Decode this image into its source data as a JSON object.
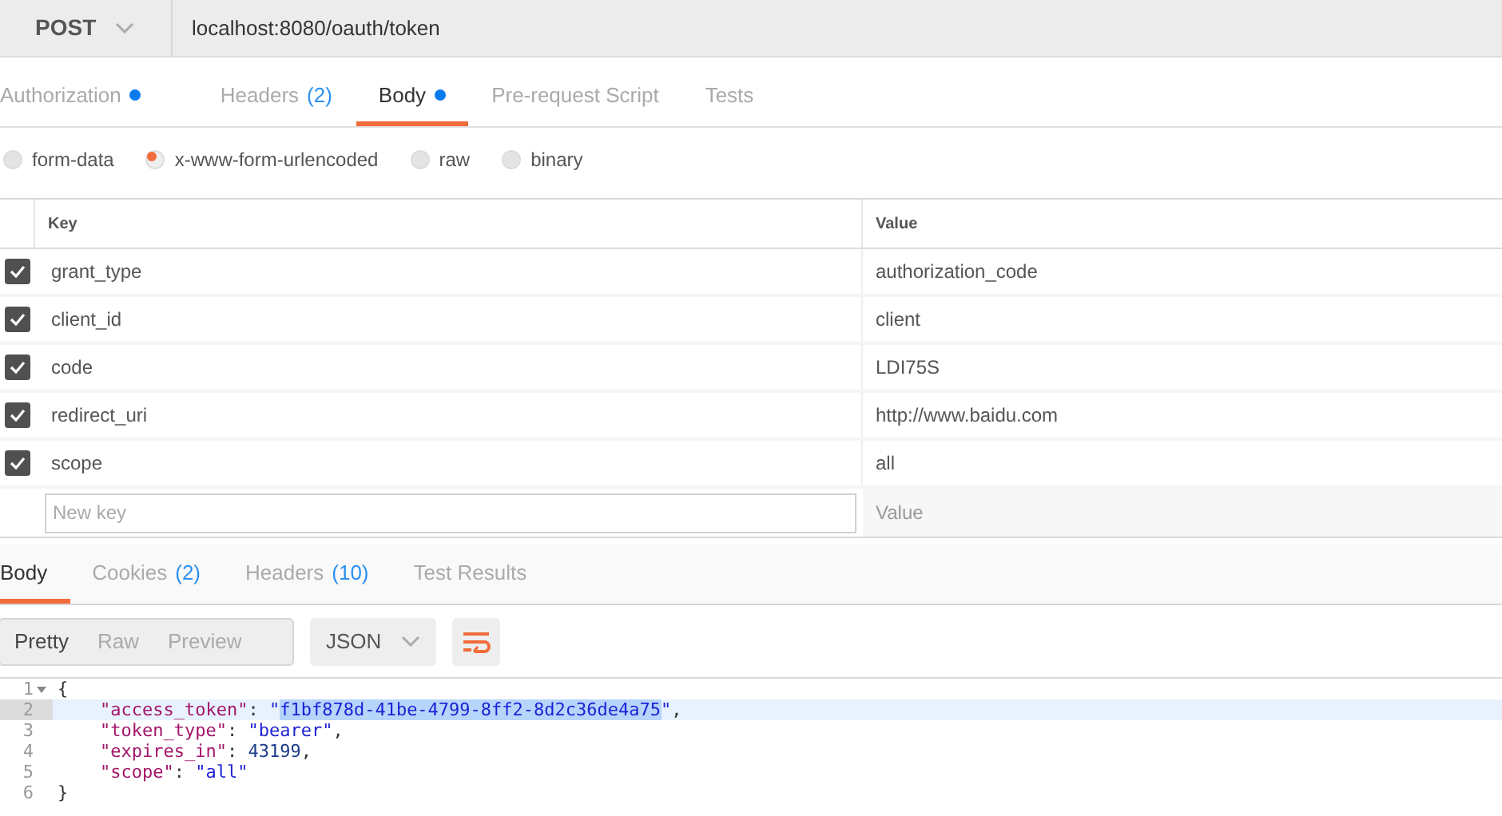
{
  "request": {
    "method": "POST",
    "url": "localhost:8080/oauth/token"
  },
  "request_tabs": [
    {
      "label": "Authorization",
      "dot": true,
      "selected": false
    },
    {
      "label": "Headers",
      "count": "(2)",
      "dot": false,
      "selected": false
    },
    {
      "label": "Body",
      "dot": true,
      "selected": true
    },
    {
      "label": "Pre-request Script",
      "dot": false,
      "selected": false
    },
    {
      "label": "Tests",
      "dot": false,
      "selected": false
    }
  ],
  "body_types": [
    {
      "label": "form-data",
      "selected": false
    },
    {
      "label": "x-www-form-urlencoded",
      "selected": true
    },
    {
      "label": "raw",
      "selected": false
    },
    {
      "label": "binary",
      "selected": false
    }
  ],
  "params_table": {
    "columns": [
      "Key",
      "Value"
    ],
    "rows": [
      {
        "key": "grant_type",
        "value": "authorization_code",
        "checked": true
      },
      {
        "key": "client_id",
        "value": "client",
        "checked": true
      },
      {
        "key": "code",
        "value": "LDI75S",
        "checked": true
      },
      {
        "key": "redirect_uri",
        "value": "http://www.baidu.com",
        "checked": true
      },
      {
        "key": "scope",
        "value": "all",
        "checked": true
      }
    ],
    "new_row": {
      "key_placeholder": "New key",
      "value_placeholder": "Value"
    }
  },
  "response_tabs": [
    {
      "label": "Body",
      "selected": true
    },
    {
      "label": "Cookies",
      "count": "(2)",
      "selected": false
    },
    {
      "label": "Headers",
      "count": "(10)",
      "selected": false
    },
    {
      "label": "Test Results",
      "selected": false
    }
  ],
  "view_modes": [
    {
      "label": "Pretty",
      "selected": true
    },
    {
      "label": "Raw",
      "selected": false
    },
    {
      "label": "Preview",
      "selected": false
    }
  ],
  "format": "JSON",
  "code_lines": [
    {
      "number": "1",
      "foldable": true,
      "active": false,
      "tokens": [
        {
          "kind": "punct",
          "text": "{"
        }
      ]
    },
    {
      "number": "2",
      "foldable": false,
      "active": true,
      "tokens": [
        {
          "kind": "key",
          "text": "    \"access_token\""
        },
        {
          "kind": "punct",
          "text": ": "
        },
        {
          "kind": "string",
          "text": "\""
        },
        {
          "kind": "selection",
          "text": "f1bf878d-41be-4799-8ff2-8d2c36de4a75"
        },
        {
          "kind": "string",
          "text": "\""
        },
        {
          "kind": "punct",
          "text": ","
        }
      ]
    },
    {
      "number": "3",
      "foldable": false,
      "active": false,
      "tokens": [
        {
          "kind": "key",
          "text": "    \"token_type\""
        },
        {
          "kind": "punct",
          "text": ": "
        },
        {
          "kind": "string",
          "text": "\"bearer\""
        },
        {
          "kind": "punct",
          "text": ","
        }
      ]
    },
    {
      "number": "4",
      "foldable": false,
      "active": false,
      "tokens": [
        {
          "kind": "key",
          "text": "    \"expires_in\""
        },
        {
          "kind": "punct",
          "text": ": "
        },
        {
          "kind": "number",
          "text": "43199"
        },
        {
          "kind": "punct",
          "text": ","
        }
      ]
    },
    {
      "number": "5",
      "foldable": false,
      "active": false,
      "tokens": [
        {
          "kind": "key",
          "text": "    \"scope\""
        },
        {
          "kind": "punct",
          "text": ": "
        },
        {
          "kind": "string",
          "text": "\"all\""
        }
      ]
    },
    {
      "number": "6",
      "foldable": false,
      "active": false,
      "tokens": [
        {
          "kind": "punct",
          "text": "}"
        }
      ]
    }
  ]
}
